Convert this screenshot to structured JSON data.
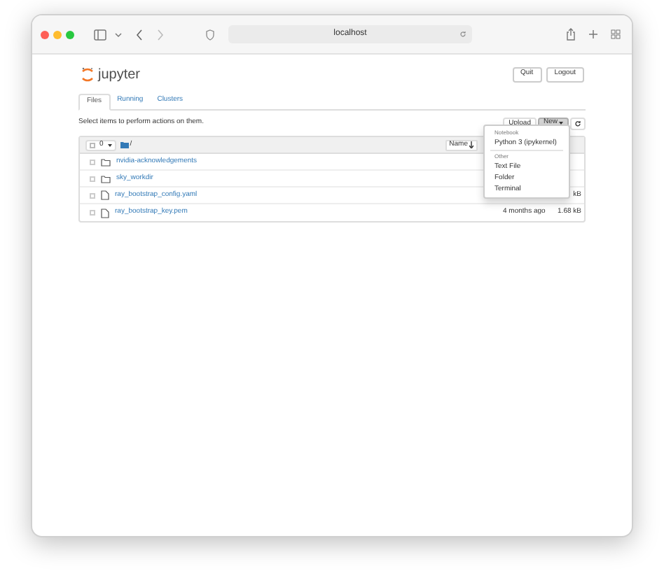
{
  "browser": {
    "url": "localhost"
  },
  "header": {
    "logo_text": "jupyter",
    "buttons": [
      "Quit",
      "Logout"
    ]
  },
  "tabs": [
    {
      "label": "Files",
      "selected": true
    },
    {
      "label": "Running",
      "selected": false
    },
    {
      "label": "Clusters",
      "selected": false
    }
  ],
  "hint": "Select items to perform actions on them.",
  "select_all": {
    "checked": false
  },
  "toolbar": {
    "upload": "Upload",
    "new": "New",
    "selected_count": "0",
    "breadcrumb": "/",
    "sort_column": "Name"
  },
  "rows": [
    {
      "kind": "folder",
      "checked": false,
      "name": "nvidia-acknowledgements"
    },
    {
      "kind": "folder",
      "checked": false,
      "name": "sky_workdir"
    },
    {
      "kind": "file",
      "checked": false,
      "name": "ray_bootstrap_config.yaml",
      "size": "kB"
    },
    {
      "kind": "file",
      "checked": false,
      "name": "ray_bootstrap_key.pem",
      "modified": "4 months ago",
      "size": "1.68 kB"
    }
  ],
  "new_menu": {
    "sections": [
      {
        "header": "Notebook",
        "items": [
          "Python 3 (ipykernel)"
        ]
      },
      {
        "header": "Other",
        "items": [
          "Text File",
          "Folder",
          "Terminal"
        ]
      }
    ]
  }
}
